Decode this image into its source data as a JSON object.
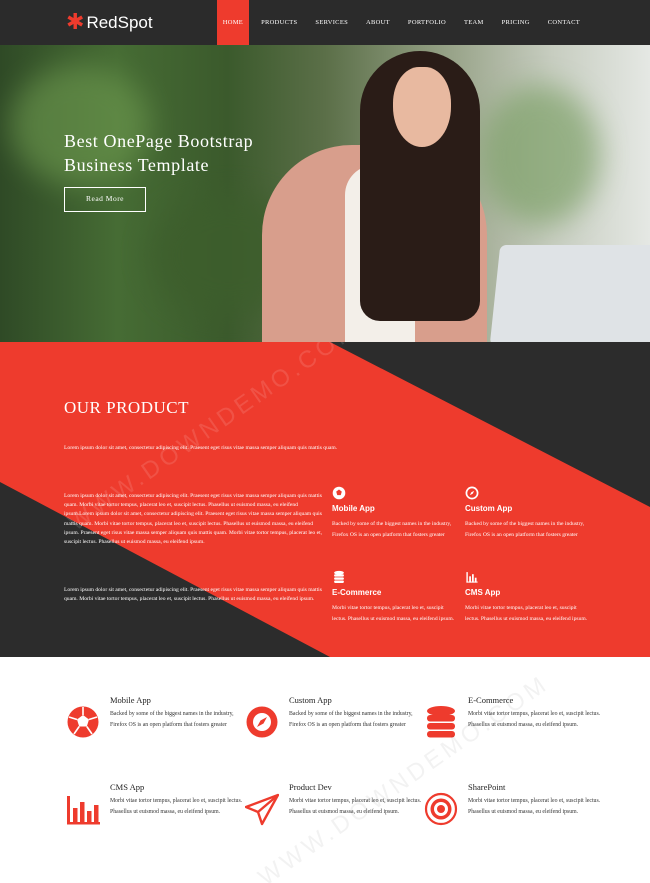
{
  "brand": {
    "name": "RedSpot",
    "icon": "asterisk-logo-icon"
  },
  "nav": {
    "items": [
      "HOME",
      "PRODUCTS",
      "SERVICES",
      "ABOUT",
      "PORTFOLIO",
      "TEAM",
      "PRICING",
      "CONTACT"
    ],
    "active": "HOME"
  },
  "hero": {
    "title_line1": "Best OnePage Bootstrap",
    "title_line2": "Business Template",
    "button": "Read More"
  },
  "product": {
    "heading": "OUR PRODUCT",
    "intro": "Lorem ipsum dolor sit amet, consectetur adipiscing elit. Praesent eget risus vitae massa semper aliquam quis mattis quam.",
    "para1": "Lorem ipsum dolor sit amet, consectetur adipiscing elit. Praesent eget risus vitae massa semper aliquam quis mattis quam. Morbi vitae tortor tempus, placerat leo et, suscipit lectus. Phasellus ut euismod massa, eu eleifend ipsum.Lorem ipsum dolor sit amet, consectetur adipiscing elit. Praesent eget risus vitae massa semper aliquam quis mattis quam. Morbi vitae tortor tempus, placerat leo et, suscipit lectus. Phasellus ut euismod massa, eu eleifend ipsum. Praesent eget risus vitae massa semper aliquam quis mattis quam. Morbi vitae tortor tempus, placerat leo et, suscipit lectus. Phasellus ut euismod massa, eu eleifend ipsum.",
    "para2": "Lorem ipsum dolor sit amet, consectetur adipiscing elit. Praesent eget risus vitae massa semper aliquam quis mattis quam. Morbi vitae tortor tempus, placerat leo et, suscipit lectus. Phasellus ut euismod massa, eu eleifend ipsum.",
    "features": [
      {
        "title": "Mobile App",
        "icon": "soccer-ball-icon",
        "desc": "Backed by some of the biggest names in the industry, Firefox OS is an open platform that fosters greater"
      },
      {
        "title": "Custom App",
        "icon": "compass-icon",
        "desc": "Backed by some of the biggest names in the industry, Firefox OS is an open platform that fosters greater"
      },
      {
        "title": "E-Commerce",
        "icon": "database-icon",
        "desc": "Morbi vitae tortor tempus, placerat leo et, suscipit lectus. Phasellus ut euismod massa, eu eleifend ipsum."
      },
      {
        "title": "CMS App",
        "icon": "bar-chart-icon",
        "desc": "Morbi vitae tortor tempus, placerat leo et, suscipit lectus. Phasellus ut euismod massa, eu eleifend ipsum."
      }
    ]
  },
  "services": [
    {
      "title": "Mobile App",
      "icon": "soccer-ball-icon",
      "desc": "Backed by some of the biggest names in the industry, Firefox OS is an open platform that fosters greater"
    },
    {
      "title": "Custom App",
      "icon": "compass-icon",
      "desc": "Backed by some of the biggest names in the industry, Firefox OS is an open platform that fosters greater"
    },
    {
      "title": "E-Commerce",
      "icon": "database-icon",
      "desc": "Morbi vitae tortor tempus, placerat leo et, suscipit lectus. Phasellus ut euismod massa, eu eleifend ipsum."
    },
    {
      "title": "CMS App",
      "icon": "bar-chart-icon",
      "desc": "Morbi vitae tortor tempus, placerat leo et, suscipit lectus. Phasellus ut euismod massa, eu eleifend ipsum."
    },
    {
      "title": "Product Dev",
      "icon": "paper-plane-icon",
      "desc": "Morbi vitae tortor tempus, placerat leo et, suscipit lectus. Phasellus ut euismod massa, eu eleifend ipsum."
    },
    {
      "title": "SharePoint",
      "icon": "target-icon",
      "desc": "Morbi vitae tortor tempus, placerat leo et, suscipit lectus. Phasellus ut euismod massa, eu eleifend ipsum."
    }
  ],
  "watermark": "WWW.DOWNDEMO.COM",
  "colors": {
    "accent": "#ee3b2d",
    "dark": "#2b2b2b",
    "text": "#333333"
  }
}
